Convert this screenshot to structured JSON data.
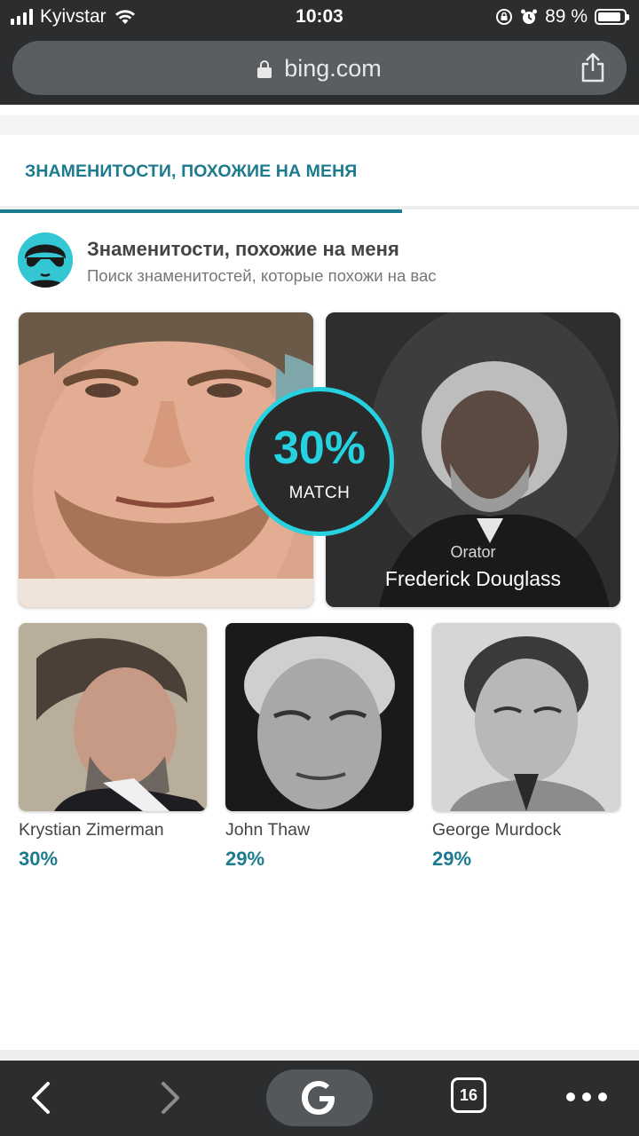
{
  "status_bar": {
    "carrier": "Kyivstar",
    "time": "10:03",
    "battery": "89 %",
    "battery_level": 0.89
  },
  "address_bar": {
    "url": "bing.com",
    "icons": [
      "lock-icon",
      "share-icon"
    ]
  },
  "tabs": [
    {
      "label": "ЗНАМЕНИТОСТИ, ПОХОЖИЕ НА МЕНЯ",
      "active": true
    }
  ],
  "app_header": {
    "title": "Знаменитости, похожие на меня",
    "subtitle": "Поиск знаменитостей, которые похожи на вас"
  },
  "main_match": {
    "percent": "30%",
    "label": "MATCH",
    "celebrity": {
      "role": "Orator",
      "name": "Frederick Douglass"
    }
  },
  "other_matches": [
    {
      "name": "Krystian Zimerman",
      "percent": "30%"
    },
    {
      "name": "John Thaw",
      "percent": "29%"
    },
    {
      "name": "George Murdock",
      "percent": "29%"
    }
  ],
  "toolbar": {
    "tab_count": "16",
    "icons": [
      "back-icon",
      "forward-icon",
      "google-icon",
      "tabs-icon",
      "more-icon"
    ]
  },
  "colors": {
    "accent": "#1d7b8f",
    "match_ring": "#27d2e0",
    "chrome": "#2b2d2f"
  }
}
